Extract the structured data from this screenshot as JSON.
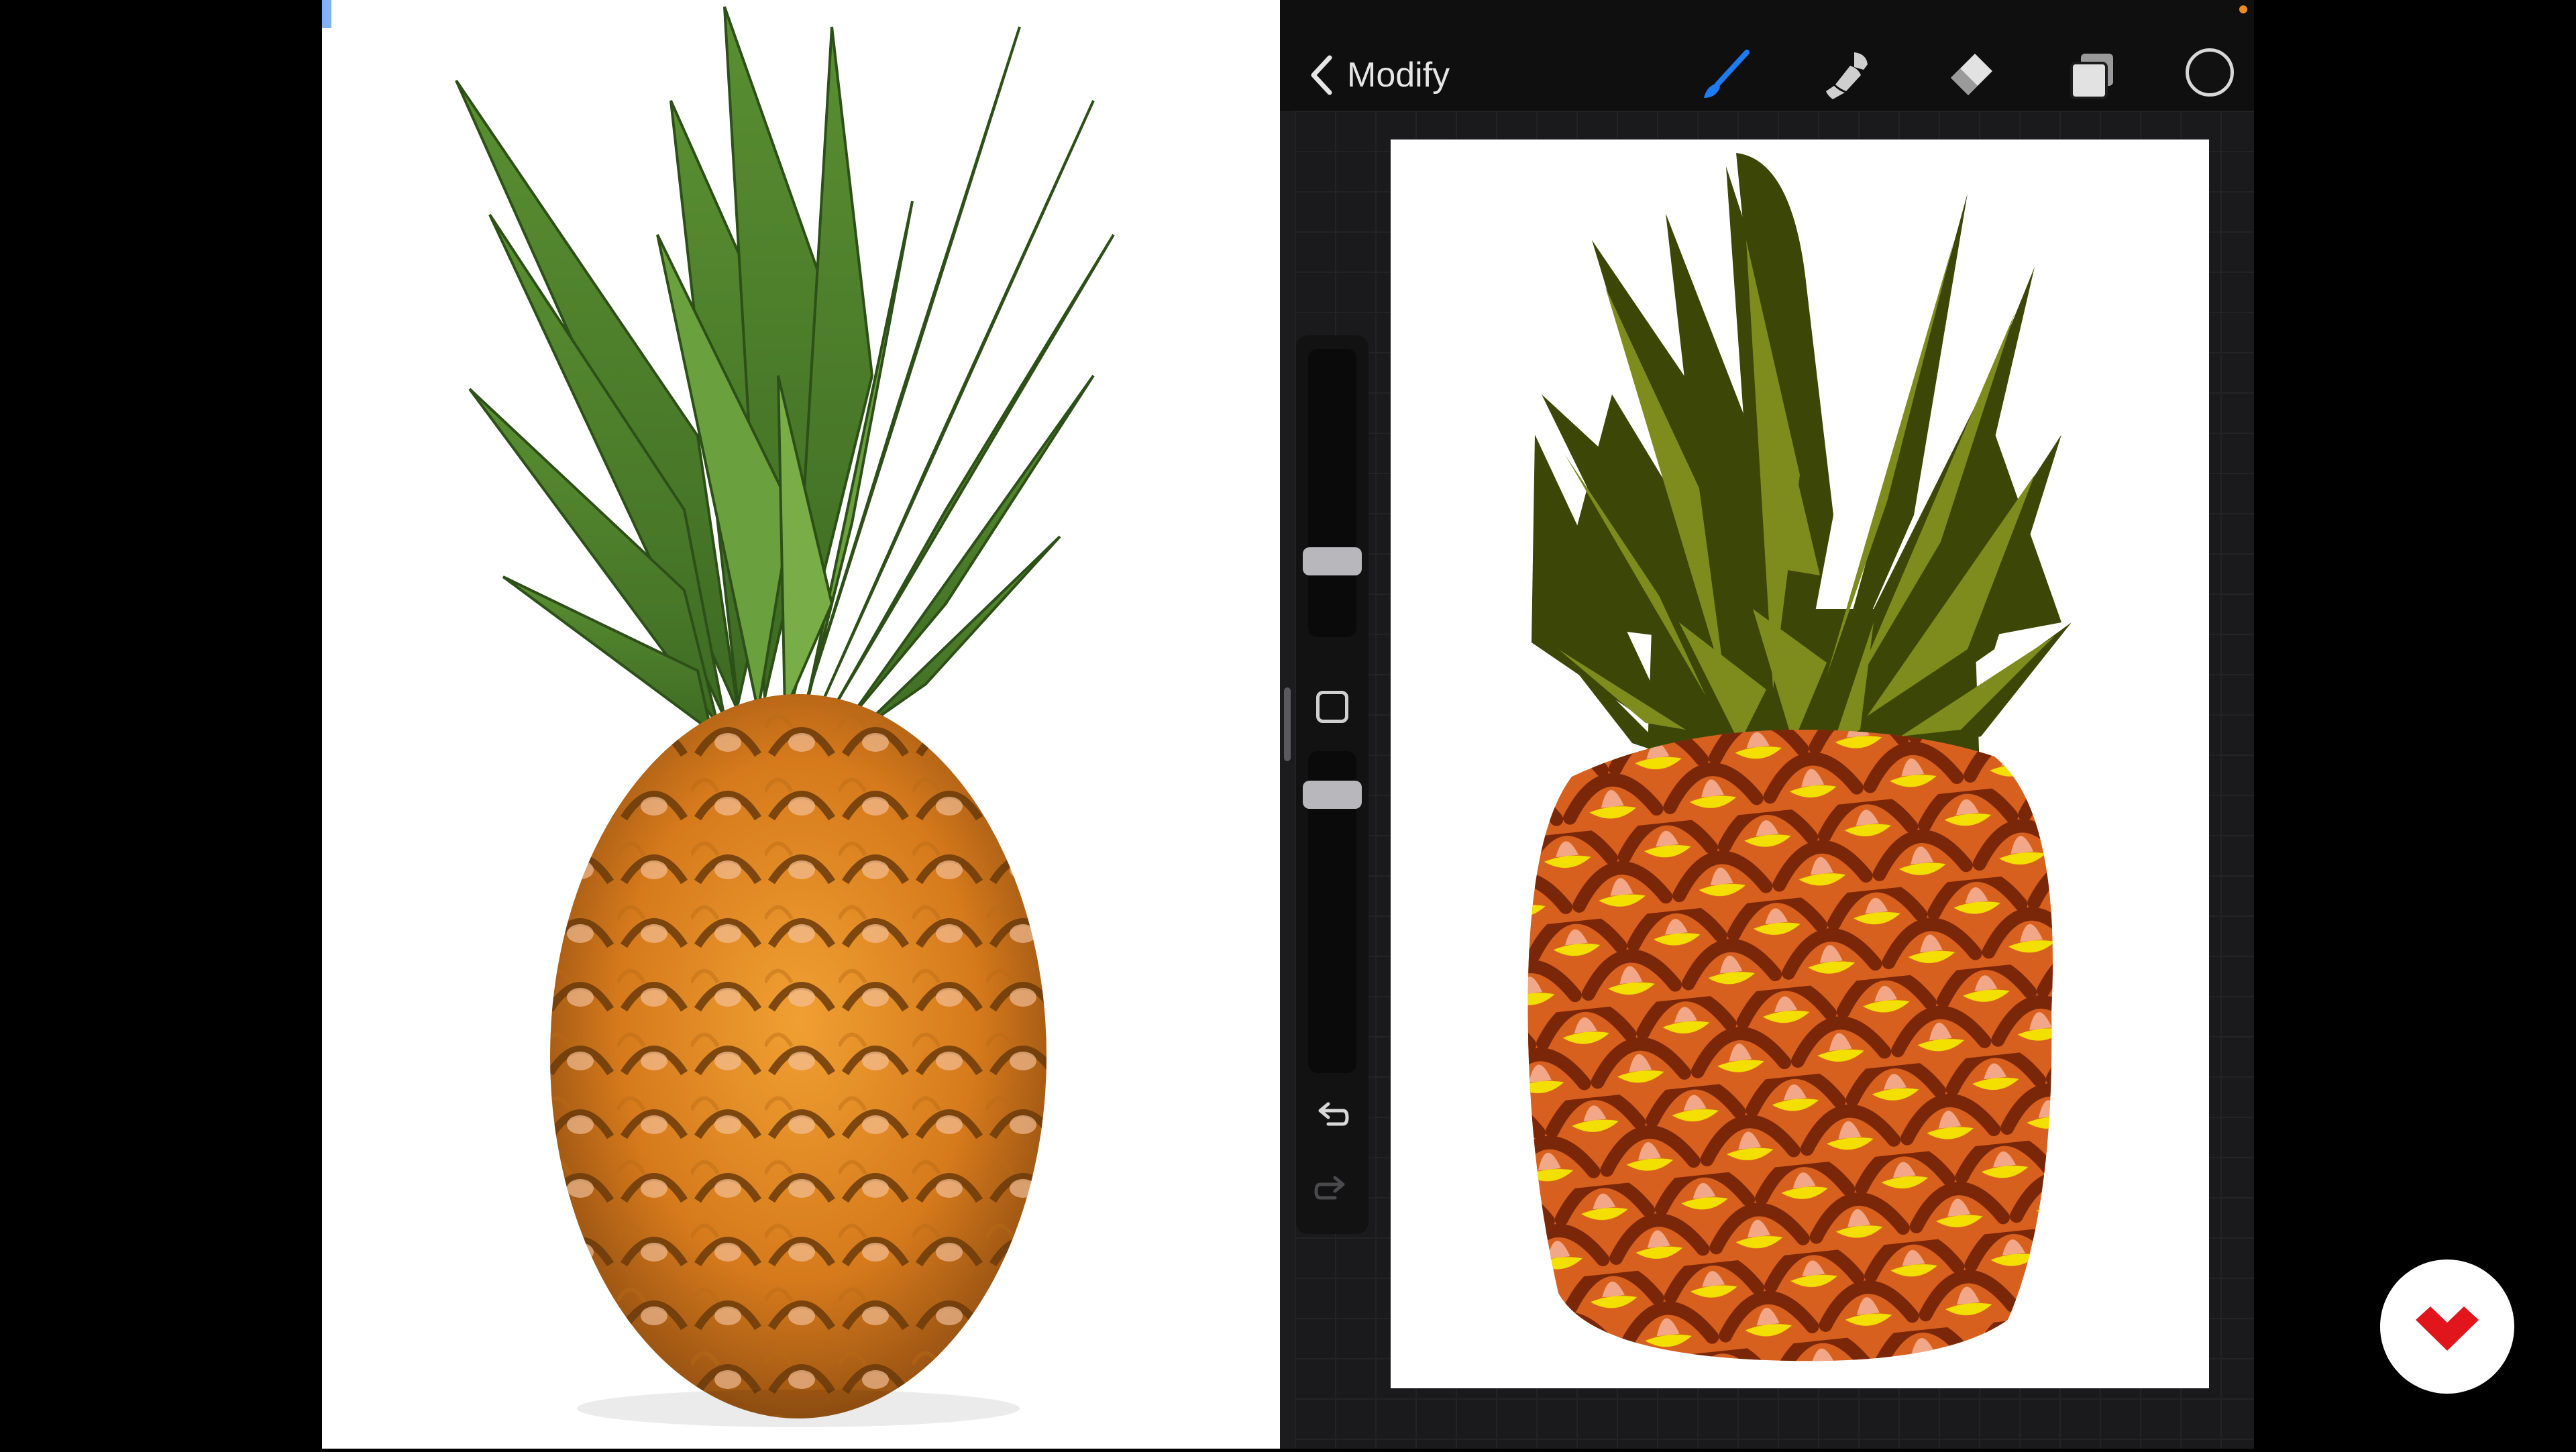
{
  "toolbar": {
    "back_label": "Modify",
    "tools": [
      {
        "name": "brush",
        "icon": "brush-icon",
        "active": true,
        "color": "#1e7cf2"
      },
      {
        "name": "smudge",
        "icon": "smudge-icon",
        "active": false,
        "color": "#cfcfcf"
      },
      {
        "name": "eraser",
        "icon": "eraser-icon",
        "active": false,
        "color": "#cfcfcf"
      },
      {
        "name": "layers",
        "icon": "layers-icon",
        "active": false,
        "color": "#cfcfcf"
      }
    ],
    "current_color": "#111111"
  },
  "sidebar": {
    "controls": [
      "brush-size-slider",
      "modify-button",
      "opacity-slider",
      "undo-button",
      "redo-button"
    ]
  },
  "colors": {
    "accent": "#1e7cf2",
    "crown_dark": "#3c4606",
    "crown_light": "#7d8c1c",
    "body_orange": "#d8601e",
    "body_outline": "#7a2608",
    "scale_yellow": "#f4e000",
    "scale_pink": "#f2a888",
    "logo_red": "#e0161c"
  }
}
